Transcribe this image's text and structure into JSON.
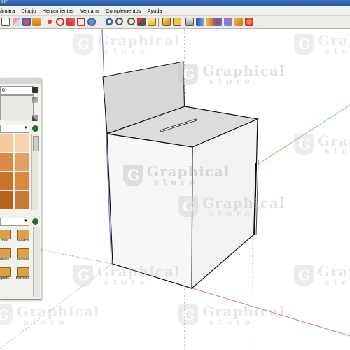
{
  "window": {
    "title_fragment": "Up"
  },
  "menu": {
    "items": [
      "ámara",
      "Dibujo",
      "Herramientas",
      "Ventana",
      "Complementos",
      "Ayuda"
    ]
  },
  "toolbar": {
    "tools": [
      "rectangle-tool-icon",
      "eraser-tool-icon",
      "paint-bucket-icon",
      "push-pull-icon",
      "move-tool-icon",
      "rotate-tool-icon",
      "follow-me-icon",
      "scale-tool-icon",
      "orbit-icon",
      "pan-icon",
      "zoom-icon",
      "zoom-window-icon",
      "zoom-extents-icon",
      "previous-view-icon",
      "iso-view-icon",
      "top-view-icon",
      "front-view-icon",
      "right-view-icon",
      "back-view-icon",
      "left-view-icon",
      "xray-icon",
      "wireframe-icon",
      "hidden-line-icon",
      "shaded-icon",
      "textured-icon",
      "get-models-icon",
      "share-model-icon",
      "components-icon",
      "ruby-icon"
    ]
  },
  "materials_panel": {
    "top_value": "0",
    "swatches": [
      "#f3c89c",
      "#f6d3ad",
      "#d98a4a",
      "#e0a067",
      "#c9742c",
      "#d8893e",
      "#b5621e",
      "#c57a35"
    ],
    "folders": [
      "dosa",
      "Bocetos",
      "drillos",
      "Madera",
      "queta",
      "Persiana"
    ],
    "colors": {
      "panel_bg": "#f2f1ec",
      "folder": "#d9a24a"
    }
  },
  "watermark": {
    "title": "Graphical",
    "subtitle": "store"
  },
  "scene": {
    "colors": {
      "red_axis": "#d9a0a0",
      "green_axis": "#7fd07f",
      "blue_axis": "#6060d8",
      "edge": "#111111",
      "face": "#f7f7f7",
      "shade": "#dcdcdc"
    }
  }
}
